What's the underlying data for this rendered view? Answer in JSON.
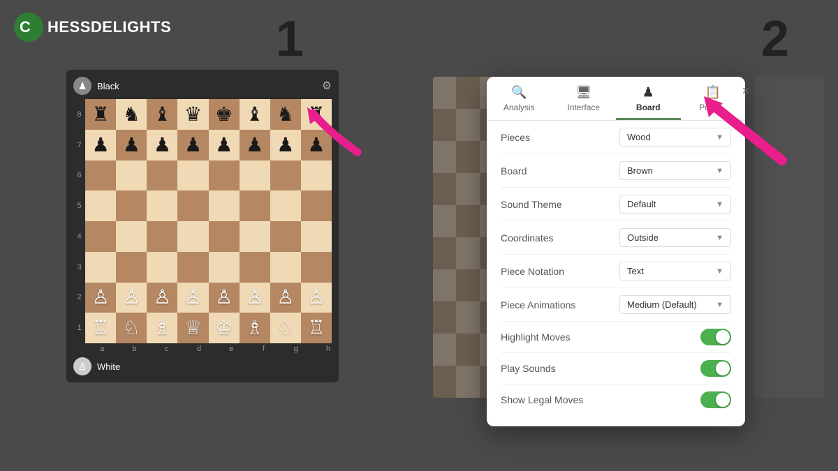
{
  "logo": {
    "text_chess": "C",
    "text_hess": "HESS",
    "text_delights": "DELIGHTS"
  },
  "steps": {
    "step1": "1",
    "step2": "2"
  },
  "chess_panel": {
    "black_label": "Black",
    "white_label": "White",
    "gear_symbol": "⚙",
    "rank_labels": [
      "8",
      "7",
      "6",
      "5",
      "4",
      "3",
      "2",
      "1"
    ],
    "file_labels": [
      "a",
      "b",
      "c",
      "d",
      "e",
      "f",
      "g",
      "h"
    ]
  },
  "settings": {
    "tabs": [
      {
        "id": "analysis",
        "icon": "🔍",
        "label": "Analysis"
      },
      {
        "id": "interface",
        "icon": "🖥",
        "label": "Interface"
      },
      {
        "id": "board",
        "icon": "♟",
        "label": "Board",
        "active": true
      }
    ],
    "close_label": "×",
    "rows": [
      {
        "label": "Pieces",
        "type": "dropdown",
        "value": "Wood"
      },
      {
        "label": "Board",
        "type": "dropdown",
        "value": "Brown"
      },
      {
        "label": "Sound Theme",
        "type": "dropdown",
        "value": "Default"
      },
      {
        "label": "Coordinates",
        "type": "dropdown",
        "value": "Outside"
      },
      {
        "label": "Piece Notation",
        "type": "dropdown",
        "value": "Text"
      },
      {
        "label": "Piece Animations",
        "type": "dropdown",
        "value": "Medium (Default)"
      },
      {
        "label": "Highlight Moves",
        "type": "toggle",
        "value": true
      },
      {
        "label": "Play Sounds",
        "type": "toggle",
        "value": true
      },
      {
        "label": "Show Legal Moves",
        "type": "toggle",
        "value": true
      }
    ]
  }
}
